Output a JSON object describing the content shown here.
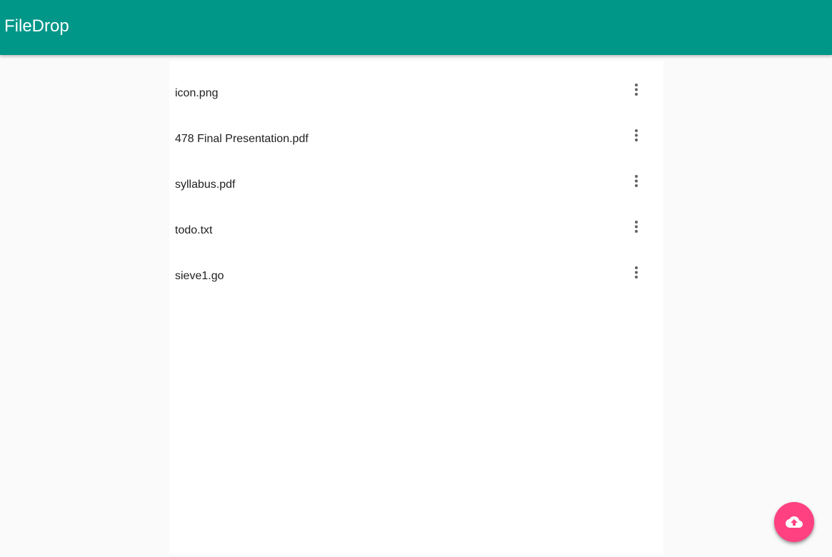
{
  "app": {
    "title": "FileDrop",
    "accent_color": "#009688",
    "fab_color": "#ff4081"
  },
  "files": [
    {
      "name": "icon.png",
      "menu_icon": "more-vert-icon"
    },
    {
      "name": "478 Final Presentation.pdf",
      "menu_icon": "more-vert-icon"
    },
    {
      "name": "syllabus.pdf",
      "menu_icon": "more-vert-icon"
    },
    {
      "name": "todo.txt",
      "menu_icon": "more-vert-icon"
    },
    {
      "name": "sieve1.go",
      "menu_icon": "more-vert-icon"
    }
  ],
  "fab": {
    "icon": "cloud-upload-icon"
  }
}
